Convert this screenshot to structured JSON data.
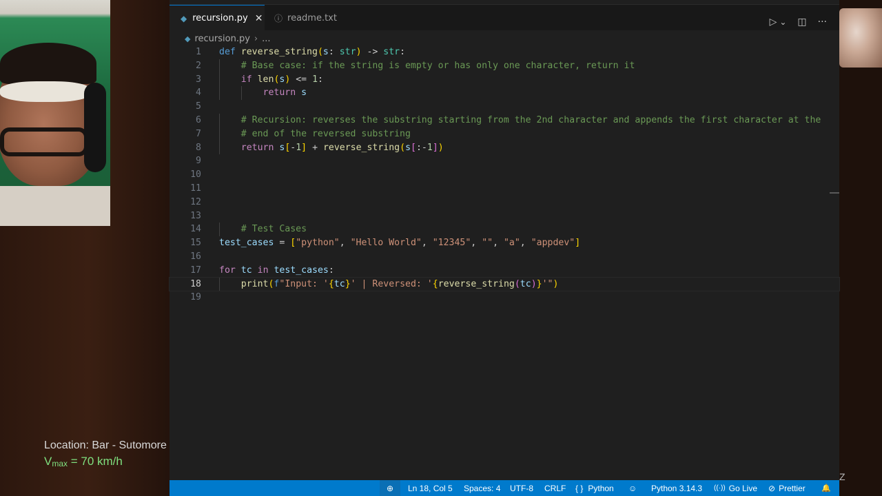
{
  "overlay": {
    "location": "Location: Bar - Sutomore",
    "vmax_v": "V",
    "vmax_sub": "max",
    "vmax_rest": " = 70 km/h",
    "corner_mark": "Z"
  },
  "tabs": [
    {
      "label": "recursion.py",
      "close": "✕",
      "icon": "python-file-icon"
    },
    {
      "label": "readme.txt",
      "icon": "info-file-icon"
    }
  ],
  "actions": {
    "run_icon": "▷",
    "dropdown_icon": "⌄",
    "split_icon": "◫",
    "more_icon": "···"
  },
  "breadcrumb": {
    "file": "recursion.py",
    "sep": "›",
    "rest": "..."
  },
  "editor": {
    "current_line": 18
  },
  "status": {
    "zoom_icon": "⊕",
    "position": "Ln 18, Col 5",
    "spaces": "Spaces: 4",
    "encoding": "UTF-8",
    "eol": "CRLF",
    "braces": "{ }",
    "language": "Python",
    "copilot_icon": "☺",
    "interpreter": "Python 3.14.3",
    "golive_icon": "((·))",
    "golive": "Go Live",
    "prettier_icon": "⊘",
    "prettier": "Prettier",
    "bell_icon": "🔔"
  },
  "code_lines": [
    "def reverse_string(s: str) -> str:",
    "    # Base case: if the string is empty or has only one character, return it",
    "    if len(s) <= 1:",
    "        return s",
    "",
    "    # Recursion: reverses the substring starting from the 2nd character and appends the first character at the",
    "    # end of the reversed substring",
    "    return s[-1] + reverse_string(s[:-1])",
    "",
    "",
    "",
    "",
    "",
    "    # Test Cases",
    "test_cases = [\"python\", \"Hello World\", \"12345\", \"\", \"a\", \"appdev\"]",
    "",
    "for tc in test_cases:",
    "    print(f\"Input: '{tc}' | Reversed: '{reverse_string(tc)}'\")",
    ""
  ]
}
